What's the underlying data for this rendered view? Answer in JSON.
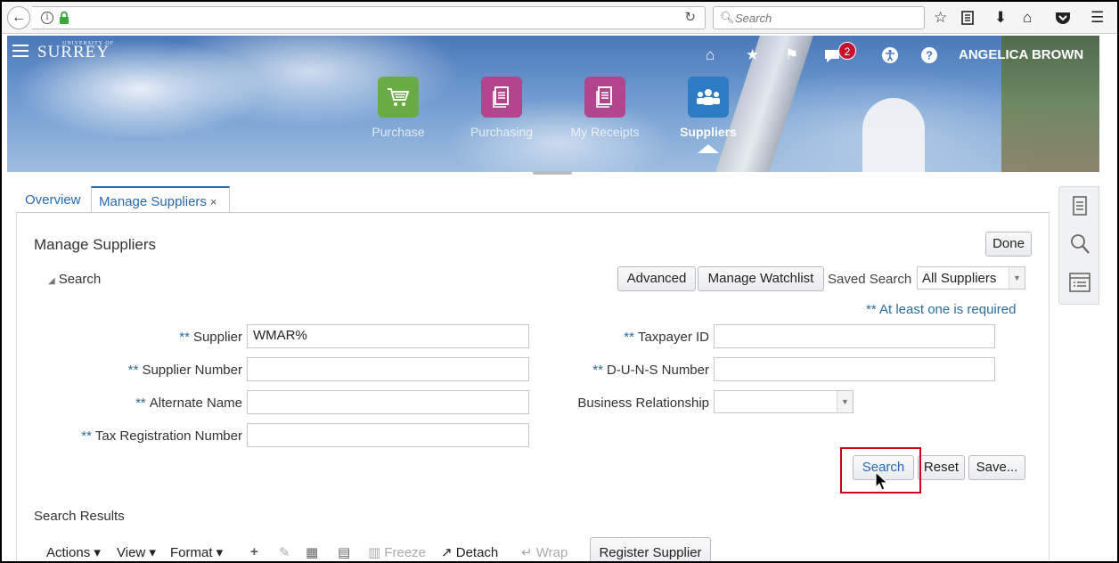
{
  "browser": {
    "search_placeholder": "Search"
  },
  "header": {
    "brand_small": "UNIVERSITY OF",
    "brand": "SURREY",
    "notification_count": "2",
    "user_name": "ANGELICA BROWN"
  },
  "apps": [
    {
      "label": "Purchase",
      "icon": "cart-icon",
      "color": "#6aac44"
    },
    {
      "label": "Purchasing",
      "icon": "document-icon",
      "color": "#b2468e"
    },
    {
      "label": "My Receipts",
      "icon": "document-icon",
      "color": "#b2468e"
    },
    {
      "label": "Suppliers",
      "icon": "group-icon",
      "color": "#2c7bc4"
    }
  ],
  "tabs": {
    "overview": "Overview",
    "manage": "Manage Suppliers",
    "close": "×"
  },
  "page": {
    "title": "Manage Suppliers",
    "done_button": "Done"
  },
  "search": {
    "section_label": "Search",
    "advanced_button": "Advanced",
    "watchlist_button": "Manage Watchlist",
    "saved_search_label": "Saved Search",
    "saved_search_value": "All Suppliers",
    "required_note": "** At least one is required",
    "required_mark": "**",
    "fields": {
      "supplier_label": "Supplier",
      "supplier_value": "WMAR%",
      "supplier_number_label": "Supplier Number",
      "alternate_name_label": "Alternate Name",
      "tax_reg_label": "Tax Registration Number",
      "taxpayer_id_label": "Taxpayer ID",
      "duns_label": "D-U-N-S Number",
      "business_rel_label": "Business Relationship"
    },
    "search_button": "Search",
    "reset_button": "Reset",
    "save_button": "Save..."
  },
  "results": {
    "title": "Search Results",
    "actions": "Actions",
    "view": "View",
    "format": "Format",
    "freeze": "Freeze",
    "detach": "Detach",
    "wrap": "Wrap",
    "register_button": "Register Supplier"
  },
  "colors": {
    "accent": "#2a6ab0",
    "required": "#2b6d96",
    "highlight": "#d0021b"
  }
}
